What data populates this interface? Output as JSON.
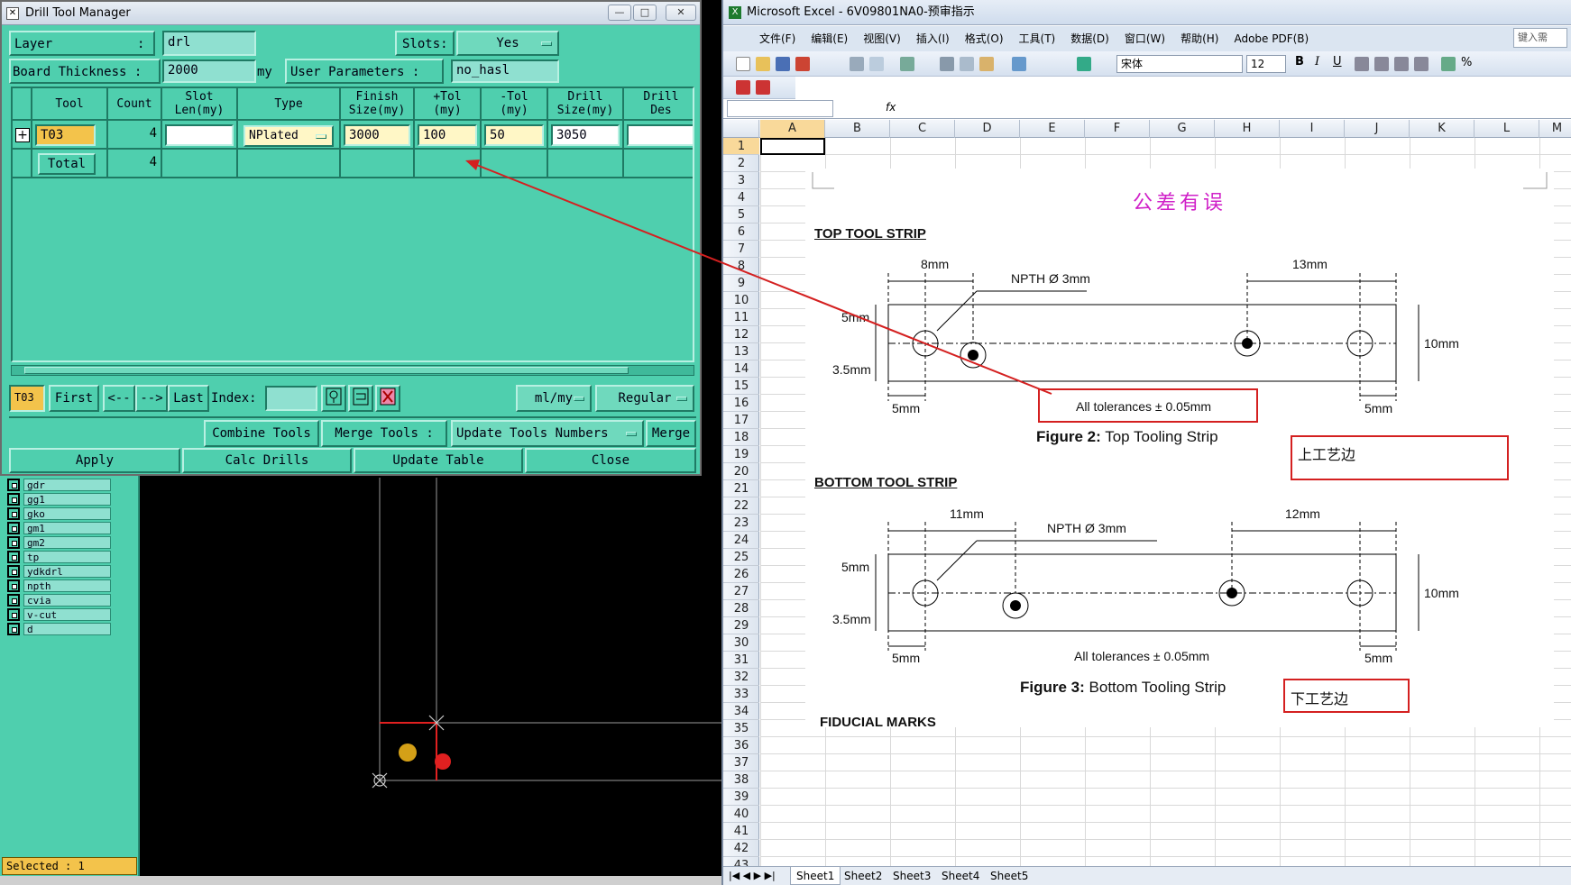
{
  "cam": {
    "layers": [
      "gdr",
      "gg1",
      "gko",
      "gm1",
      "gm2",
      "tp",
      "ydkdrl",
      "npth",
      "cvia",
      "v-cut",
      "d"
    ],
    "selected": "Selected : 1"
  },
  "dtm": {
    "title": "Drill Tool Manager",
    "layer_label": "Layer",
    "layer_sep": ":",
    "layer_value": "drl",
    "slots_label": "Slots:",
    "slots_value": "Yes",
    "board_thickness_label": "Board Thickness :",
    "board_thickness_value": "2000",
    "board_thickness_unit": "my",
    "user_params_label": "User Parameters :",
    "user_params_value": "no_hasl",
    "columns": [
      "Tool",
      "Count",
      "Slot\nLen(my)",
      "Type",
      "Finish\nSize(my)",
      "+Tol\n(my)",
      "-Tol\n(my)",
      "Drill\nSize(my)",
      "Drill\nDes"
    ],
    "row": {
      "tool": "T03",
      "count": "4",
      "slot_len": "",
      "type": "NPlated",
      "finish": "3000",
      "plus_tol": "100",
      "minus_tol": "50",
      "drill_size": "3050",
      "drill_des": ""
    },
    "total_label": "Total",
    "total_count": "4",
    "nav": {
      "current": "T03",
      "first": "First",
      "prev": "<--",
      "next": "-->",
      "last": "Last",
      "index_label": "Index:",
      "units": "ml/my",
      "mode": "Regular"
    },
    "actions": {
      "combine": "Combine Tools",
      "merge_tools": "Merge Tools :",
      "update_numbers": "Update Tools Numbers",
      "merge": "Merge",
      "apply": "Apply",
      "calc": "Calc Drills",
      "update_table": "Update Table",
      "close": "Close"
    }
  },
  "excel": {
    "title": "Microsoft Excel - 6V09801NA0-预审指示",
    "menu": [
      "文件(F)",
      "编辑(E)",
      "视图(V)",
      "插入(I)",
      "格式(O)",
      "工具(T)",
      "数据(D)",
      "窗口(W)",
      "帮助(H)",
      "Adobe PDF(B)"
    ],
    "help_box": "键入需",
    "font": "宋体",
    "font_size": "12",
    "name_box": "",
    "fx": "fx",
    "columns": [
      "A",
      "B",
      "C",
      "D",
      "E",
      "F",
      "G",
      "H",
      "I",
      "J",
      "K",
      "L",
      "M"
    ],
    "rows": [
      "1",
      "2",
      "3",
      "4",
      "5",
      "6",
      "7",
      "8",
      "9",
      "10",
      "11",
      "12",
      "13",
      "14",
      "15",
      "16",
      "17",
      "18",
      "19",
      "20",
      "21",
      "22",
      "23",
      "24",
      "25",
      "26",
      "27",
      "28",
      "29",
      "30",
      "31",
      "32",
      "33",
      "34",
      "35",
      "36",
      "37",
      "38",
      "39",
      "40",
      "41",
      "42",
      "43"
    ],
    "sheets": [
      "Sheet1",
      "Sheet2",
      "Sheet3",
      "Sheet4",
      "Sheet5"
    ],
    "doc": {
      "heading": "公差有误",
      "top_strip_title": "TOP TOOL STRIP",
      "bottom_strip_title": "BOTTOM TOOL STRIP",
      "top_dims": {
        "left": "8mm",
        "right": "13mm",
        "hole": "NPTH Ø 3mm",
        "h5": "5mm",
        "h35": "3.5mm",
        "h10": "10mm",
        "b5l": "5mm",
        "b5r": "5mm"
      },
      "bottom_dims": {
        "left": "11mm",
        "right": "12mm",
        "hole": "NPTH Ø 3mm",
        "h5": "5mm",
        "h35": "3.5mm",
        "h10": "10mm",
        "b5l": "5mm",
        "b5r": "5mm"
      },
      "tolerance_note": "All tolerances ± 0.05mm",
      "tolerance_note2": "All tolerances ± 0.05mm",
      "fig2_bold": "Figure 2:",
      "fig2_text": " Top Tooling Strip",
      "fig3_bold": "Figure 3:",
      "fig3_text": " Bottom Tooling Strip",
      "upper_edge": "上工艺边",
      "lower_edge": "下工艺边",
      "fiducial": "FIDUCIAL MARKS"
    }
  },
  "colors": {
    "dtm_bg": "#4fcfae",
    "annotation_red": "#d42020",
    "heading_magenta": "#d020c8"
  }
}
